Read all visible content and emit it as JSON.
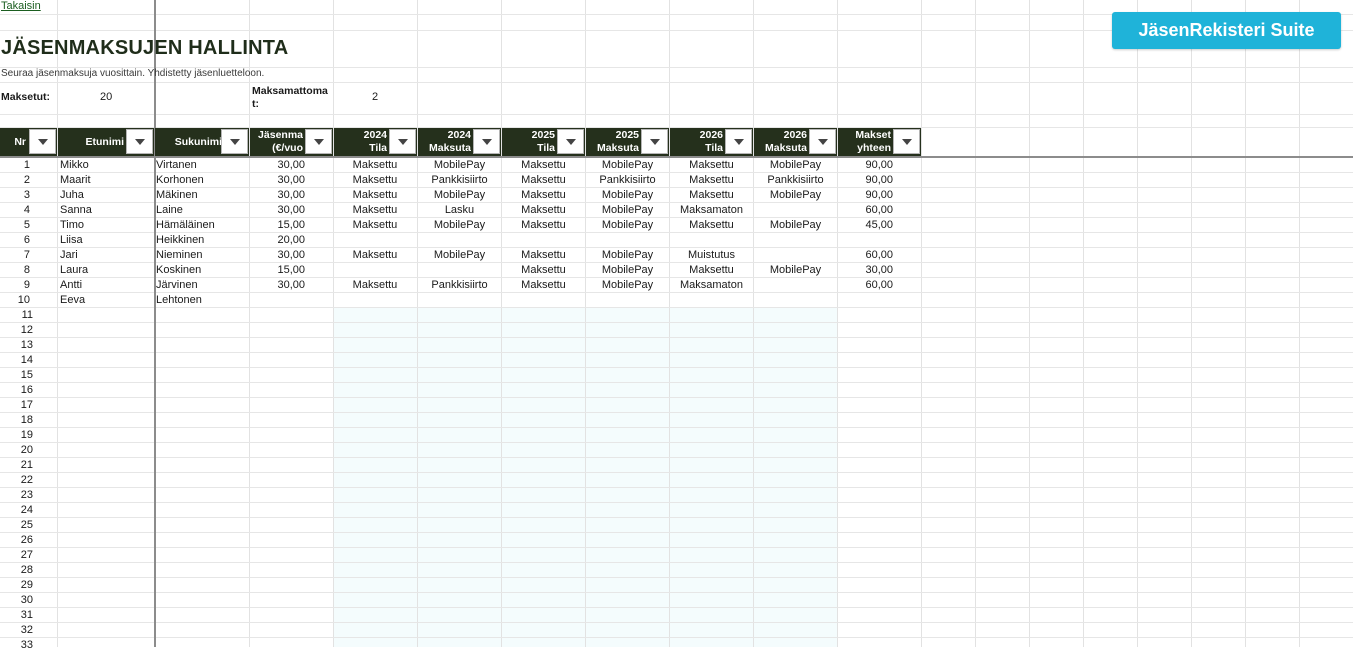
{
  "back_link": "Takaisin",
  "title": "JÄSENMAKSUJEN HALLINTA",
  "subtitle": "Seuraa jäsenmaksuja vuosittain. Yhdistetty jäsenluetteloon.",
  "stats": {
    "paid_label": "Maksetut:",
    "paid_value": "20",
    "unpaid_label_1": "Maksamattoma",
    "unpaid_label_2": "t:",
    "unpaid_value": "2"
  },
  "suite_button": "JäsenRekisteri Suite",
  "headers": [
    {
      "l1": "",
      "l2": "Nr"
    },
    {
      "l1": "",
      "l2": "Etunimi"
    },
    {
      "l1": "",
      "l2": "Sukunimi"
    },
    {
      "l1": "Jäsenma",
      "l2": "(€/vuo"
    },
    {
      "l1": "2024",
      "l2": "Tila"
    },
    {
      "l1": "2024",
      "l2": "Maksuta"
    },
    {
      "l1": "2025",
      "l2": "Tila"
    },
    {
      "l1": "2025",
      "l2": "Maksuta"
    },
    {
      "l1": "2026",
      "l2": "Tila"
    },
    {
      "l1": "2026",
      "l2": "Maksuta"
    },
    {
      "l1": "Makset",
      "l2": "yhteen"
    }
  ],
  "rows": [
    [
      "1",
      "Mikko",
      "Virtanen",
      "30,00",
      "Maksettu",
      "MobilePay",
      "Maksettu",
      "MobilePay",
      "Maksettu",
      "MobilePay",
      "90,00"
    ],
    [
      "2",
      "Maarit",
      "Korhonen",
      "30,00",
      "Maksettu",
      "Pankkisiirto",
      "Maksettu",
      "Pankkisiirto",
      "Maksettu",
      "Pankkisiirto",
      "90,00"
    ],
    [
      "3",
      "Juha",
      "Mäkinen",
      "30,00",
      "Maksettu",
      "MobilePay",
      "Maksettu",
      "MobilePay",
      "Maksettu",
      "MobilePay",
      "90,00"
    ],
    [
      "4",
      "Sanna",
      "Laine",
      "30,00",
      "Maksettu",
      "Lasku",
      "Maksettu",
      "MobilePay",
      "Maksamaton",
      "",
      "60,00"
    ],
    [
      "5",
      "Timo",
      "Hämäläinen",
      "15,00",
      "Maksettu",
      "MobilePay",
      "Maksettu",
      "MobilePay",
      "Maksettu",
      "MobilePay",
      "45,00"
    ],
    [
      "6",
      "Liisa",
      "Heikkinen",
      "20,00",
      "",
      "",
      "",
      "",
      "",
      "",
      ""
    ],
    [
      "7",
      "Jari",
      "Nieminen",
      "30,00",
      "Maksettu",
      "MobilePay",
      "Maksettu",
      "MobilePay",
      "Muistutus",
      "",
      "60,00"
    ],
    [
      "8",
      "Laura",
      "Koskinen",
      "15,00",
      "",
      "",
      "Maksettu",
      "MobilePay",
      "Maksettu",
      "MobilePay",
      "30,00"
    ],
    [
      "9",
      "Antti",
      "Järvinen",
      "30,00",
      "Maksettu",
      "Pankkisiirto",
      "Maksettu",
      "MobilePay",
      "Maksamaton",
      "",
      "60,00"
    ],
    [
      "10",
      "Eeva",
      "Lehtonen",
      "",
      "",
      "",
      "",
      "",
      "",
      "",
      ""
    ]
  ],
  "empty_row_numbers": [
    "11",
    "12",
    "13",
    "14",
    "15",
    "16",
    "17",
    "18",
    "19",
    "20",
    "21",
    "22",
    "23",
    "24",
    "25",
    "26",
    "27",
    "28",
    "29",
    "30",
    "31",
    "32",
    "33"
  ]
}
